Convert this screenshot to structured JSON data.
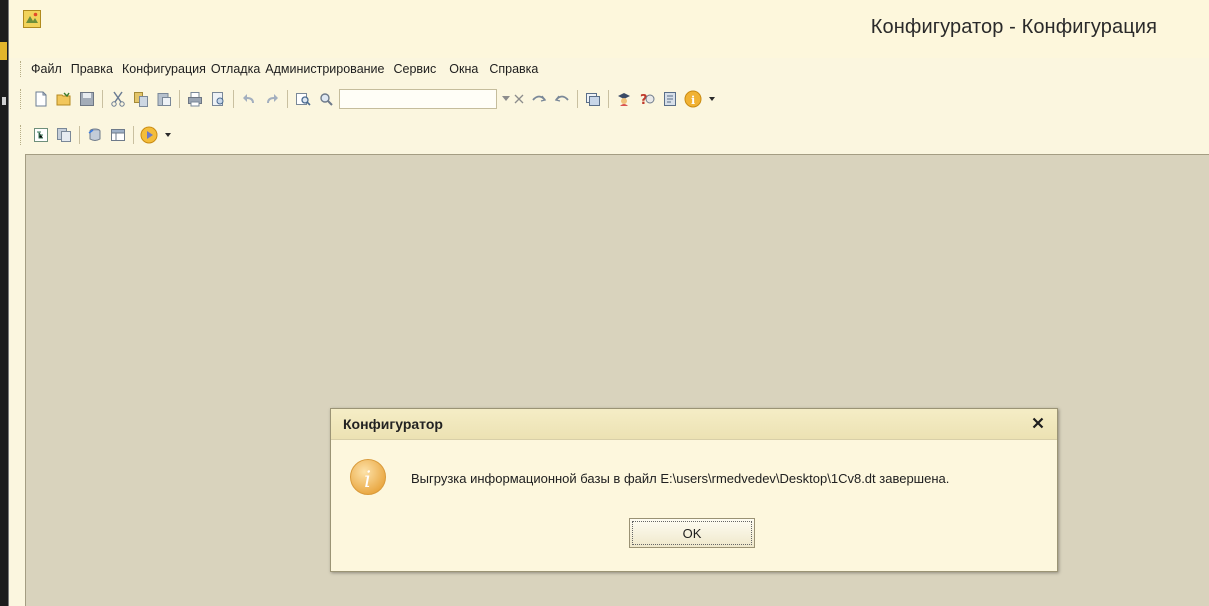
{
  "window": {
    "title": "Конфигуратор - Конфигурация"
  },
  "menu": {
    "items": [
      "Файл",
      "Правка",
      "Конфигурация",
      "Отладка",
      "Администрирование",
      "Сервис",
      "Окна",
      "Справка"
    ]
  },
  "toolbar1": {
    "search": {
      "value": ""
    },
    "icons": [
      "new-document-icon",
      "open-folder-icon",
      "save-icon",
      "cut-icon",
      "copy-icon",
      "paste-icon",
      "print-icon",
      "print-preview-icon",
      "undo-icon",
      "redo-icon",
      "find-icon",
      "find-next-icon",
      "search-dropdown-icon",
      "clear-search-icon",
      "search-up-icon",
      "search-down-icon",
      "window-icon",
      "assistant-icon",
      "syntax-help-icon",
      "reference-icon",
      "info-icon"
    ]
  },
  "toolbar2": {
    "icons": [
      "config-tree-icon",
      "config-properties-icon",
      "database-icon",
      "table-icon",
      "run-debug-icon"
    ]
  },
  "dialog": {
    "title": "Конфигуратор",
    "message": "Выгрузка информационной базы в файл E:\\users\\rmedvedev\\Desktop\\1Cv8.dt завершена.",
    "ok_label": "OK"
  },
  "colors": {
    "window_bg": "#fbf6df",
    "workarea_bg": "#d9d3bd",
    "dialog_bg": "#fdf7dd",
    "info_icon": "#e8a33a"
  }
}
